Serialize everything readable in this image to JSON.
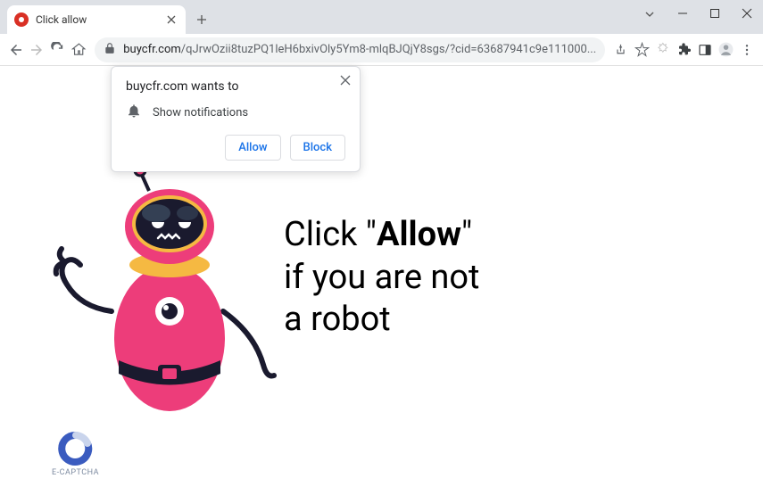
{
  "tab": {
    "title": "Click allow"
  },
  "url": {
    "domain": "buycfr.com",
    "path": "/qJrwOzii8tuzPQ1leH6bxivOly5Ym8-mlqBJQjY8sgs/?cid=63687941c9e111000..."
  },
  "notification": {
    "title": "buycfr.com wants to",
    "permission": "Show notifications",
    "allow": "Allow",
    "block": "Block"
  },
  "page": {
    "line1_pre": "Click \"",
    "line1_bold": "Allow",
    "line1_post": "\"",
    "line2": "if you are not",
    "line3": "a robot"
  },
  "ecaptcha": {
    "label": "E-CAPTCHA"
  }
}
